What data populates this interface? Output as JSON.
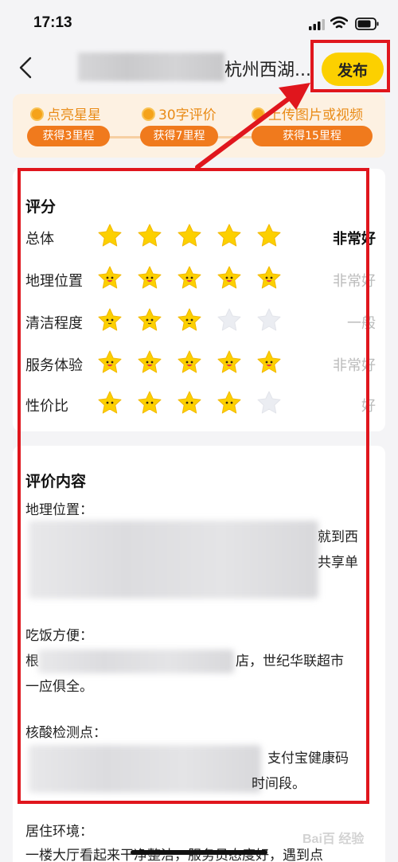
{
  "status_bar": {
    "time": "17:13"
  },
  "nav": {
    "title_visible": "杭州西湖...",
    "publish_label": "发布"
  },
  "rewards": [
    {
      "title": "点亮星星",
      "pill": "获得3里程"
    },
    {
      "title": "30字评价",
      "pill": "获得7里程"
    },
    {
      "title": "上传图片或视频",
      "pill": "获得15里程"
    }
  ],
  "rating": {
    "section_title": "评分",
    "rows": [
      {
        "label": "总体",
        "stars": 5,
        "value": "非常好"
      },
      {
        "label": "地理位置",
        "stars": 5,
        "value": "非常好"
      },
      {
        "label": "清洁程度",
        "stars": 3,
        "value": "一般"
      },
      {
        "label": "服务体验",
        "stars": 5,
        "value": "非常好"
      },
      {
        "label": "性价比",
        "stars": 4,
        "value": "好"
      }
    ]
  },
  "review": {
    "section_title": "评价内容",
    "p1_heading": "地理位置：",
    "p1_line1_tail": "就到西",
    "p1_line2_tail": "共享单",
    "p2_heading": "吃饭方便：",
    "p2_line1_head": "根",
    "p2_line1_tail": "店，世纪华联超市",
    "p2_line2": "一应俱全。",
    "p3_heading": "核酸检测点：",
    "p3_line1_tail": "支付宝健康码",
    "p3_line2_tail": "时间段。",
    "p4_heading": "居住环境：",
    "p4_line1": "一楼大厅看起来干净整洁，服务员态度好，遇到点"
  },
  "watermark": "Bai百 经验",
  "colors": {
    "accent": "#fcd000",
    "annotation": "#e0161d",
    "reward": "#f07a1d"
  }
}
